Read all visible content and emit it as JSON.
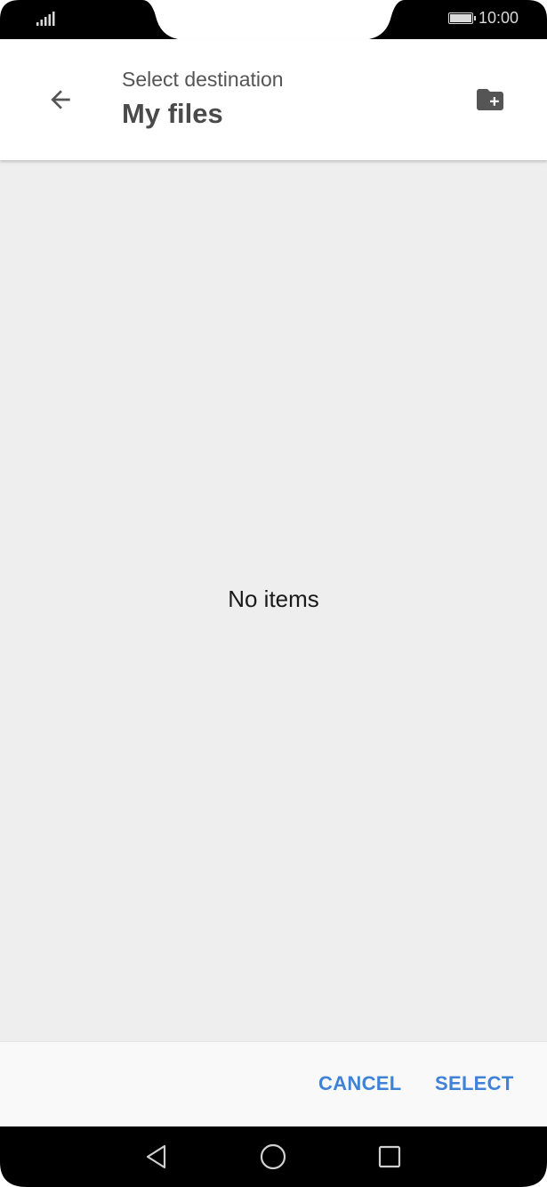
{
  "status_bar": {
    "signal_icon": "signal-bars-icon",
    "battery_icon": "battery-icon",
    "time": "10:00"
  },
  "app_bar": {
    "back_icon": "arrow-left-icon",
    "subtitle": "Select destination",
    "title": "My files",
    "new_folder_icon": "folder-plus-icon"
  },
  "content": {
    "empty_message": "No items"
  },
  "actions": {
    "cancel_label": "CANCEL",
    "select_label": "SELECT"
  },
  "navigation": {
    "back_icon": "triangle-back-icon",
    "home_icon": "circle-home-icon",
    "recent_icon": "square-recent-icon"
  },
  "colors": {
    "accent": "#3f82d8",
    "content_background": "#eeeeee",
    "title_text": "#4a4a4a"
  }
}
